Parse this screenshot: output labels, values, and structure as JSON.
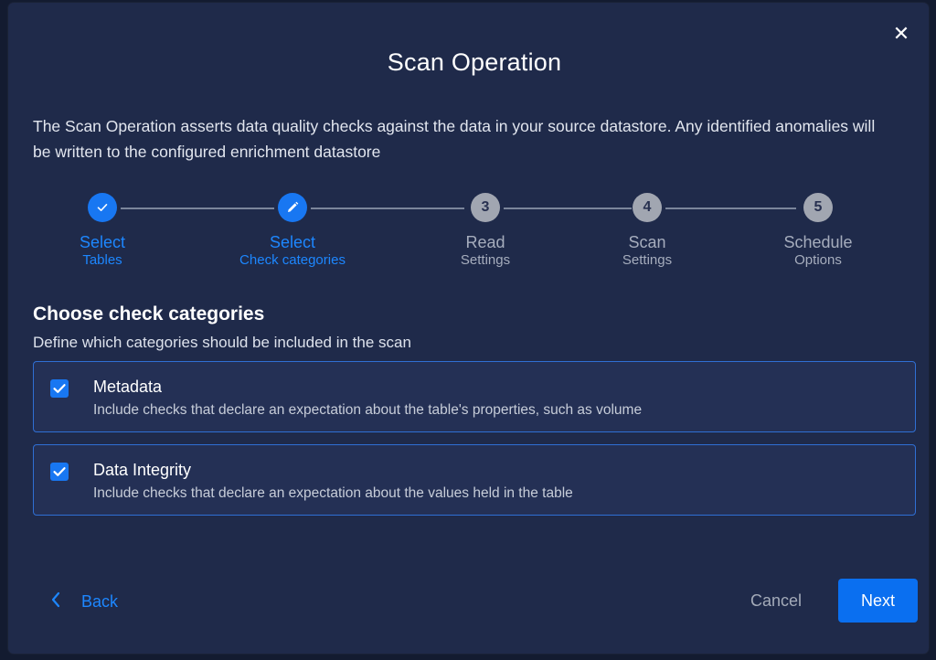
{
  "dialog": {
    "title": "Scan Operation",
    "description": "The Scan Operation asserts data quality checks against the data in your source datastore. Any identified anomalies will be written to the configured enrichment datastore"
  },
  "stepper": {
    "steps": [
      {
        "label": "Select",
        "sub": "Tables",
        "state": "completed",
        "icon": "check-icon"
      },
      {
        "label": "Select",
        "sub": "Check categories",
        "state": "current",
        "icon": "pencil-icon"
      },
      {
        "label": "Read",
        "sub": "Settings",
        "state": "pending",
        "number": "3"
      },
      {
        "label": "Scan",
        "sub": "Settings",
        "state": "pending",
        "number": "4"
      },
      {
        "label": "Schedule",
        "sub": "Options",
        "state": "pending",
        "number": "5"
      }
    ]
  },
  "categories": {
    "title": "Choose check categories",
    "subtitle": "Define which categories should be included in the scan",
    "options": [
      {
        "title": "Metadata",
        "description": "Include checks that declare an expectation about the table's properties, such as volume",
        "checked": true
      },
      {
        "title": "Data Integrity",
        "description": "Include checks that declare an expectation about the values held in the table",
        "checked": true
      }
    ]
  },
  "footer": {
    "back_label": "Back",
    "cancel_label": "Cancel",
    "next_label": "Next"
  },
  "colors": {
    "accent": "#1877f2",
    "dialog_bg": "#1f2a4a",
    "page_bg": "#131b30"
  }
}
